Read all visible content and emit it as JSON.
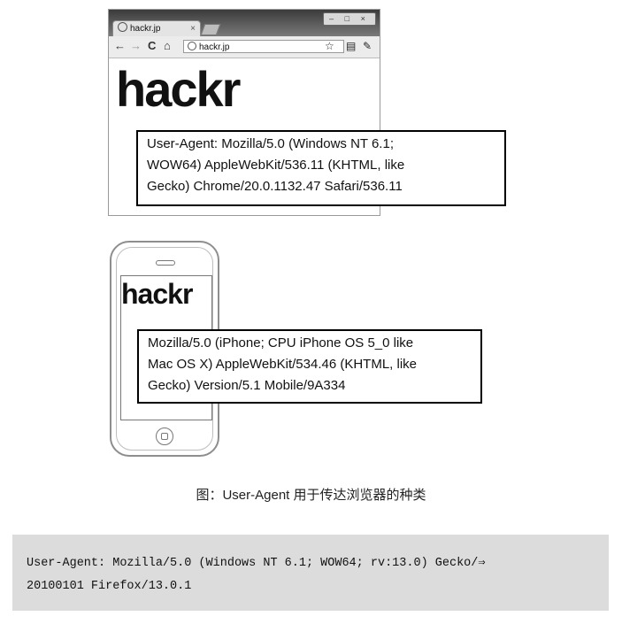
{
  "figure": {
    "browser": {
      "tab_title": "hackr.jp",
      "tab_close": "×",
      "window_controls": "– □ ×",
      "nav": {
        "back": "←",
        "forward": "→",
        "reload": "C",
        "home": "⌂"
      },
      "url": "hackr.jp",
      "icons": [
        "globe-icon",
        "star-icon",
        "page-menu-icon",
        "wrench-icon"
      ],
      "logo": "hackr",
      "user_agent_lines": [
        "User-Agent: Mozilla/5.0 (Windows NT 6.1;",
        "WOW64) AppleWebKit/536.11 (KHTML, like",
        "Gecko) Chrome/20.0.1132.47 Safari/536.11"
      ]
    },
    "phone": {
      "logo": "hackr",
      "user_agent_lines": [
        "Mozilla/5.0 (iPhone; CPU iPhone OS 5_0 like",
        "Mac OS X) AppleWebKit/534.46 (KHTML, like",
        "Gecko) Version/5.1 Mobile/9A334"
      ]
    },
    "caption": "图：User-Agent 用于传达浏览器的种类"
  },
  "code_block": {
    "lines": [
      "User-Agent: Mozilla/5.0 (Windows NT 6.1; WOW64; rv:13.0) Gecko/⇒",
      "20100101 Firefox/13.0.1"
    ]
  }
}
